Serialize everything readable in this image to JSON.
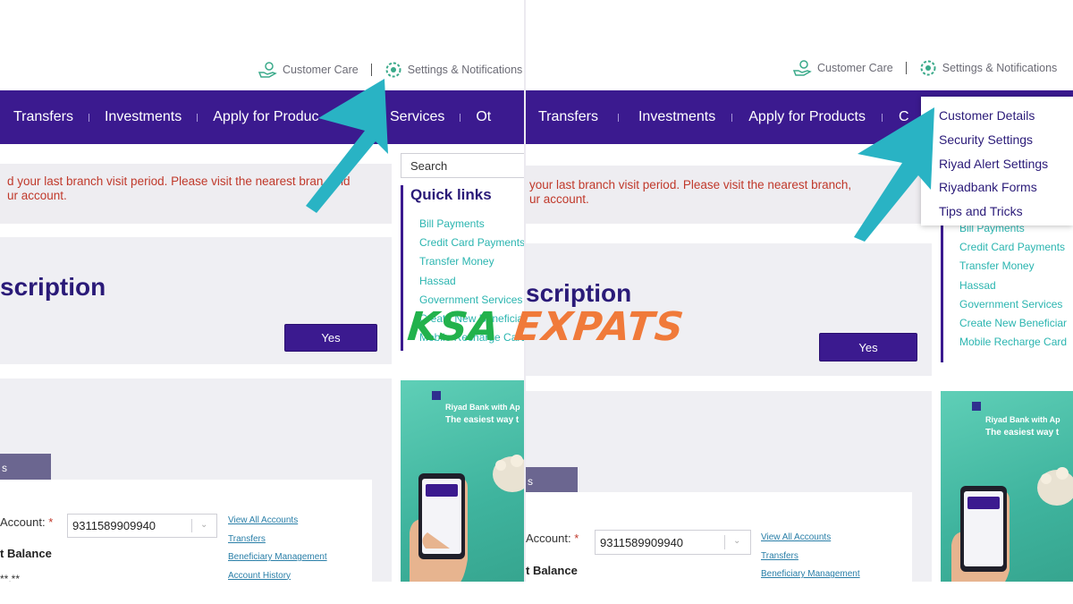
{
  "header": {
    "customer_care": "Customer Care",
    "settings_notifications": "Settings & Notifications"
  },
  "nav": {
    "left": [
      "Transfers",
      "Investments",
      "Apply for Produc",
      "Other Services",
      "Ot"
    ],
    "right": [
      "Transfers",
      "Investments",
      "Apply for Products",
      "C"
    ]
  },
  "alert": {
    "left_line1": "d your last branch visit period. Please visit the nearest bran",
    "left_line1_tail": ", and",
    "left_line2": "ur account.",
    "right_line1": "your last branch visit period. Please visit the nearest branch,",
    "right_line2": "ur account."
  },
  "subscription": {
    "title": "scription",
    "yes_label": "Yes"
  },
  "account": {
    "tab_label": "s",
    "account_label": "Account:",
    "required_mark": "*",
    "account_number": "9311589909940",
    "balance_label": "t Balance",
    "masked_balance": "**.**",
    "links": [
      "View All Accounts",
      "Transfers",
      "Beneficiary Management",
      "Account History"
    ]
  },
  "sidebar": {
    "search_placeholder": "Search",
    "quick_links_title": "Quick links",
    "quick_links_left": [
      "Bill Payments",
      "Credit Card Payments",
      "Transfer Money",
      "Hassad",
      "Government Services",
      "Create New Beneficiar",
      "Mobile Recharge Card"
    ],
    "quick_links_right": [
      "Bill Payments",
      "Credit Card Payments",
      "Transfer Money",
      "Hassad",
      "Government Services",
      "Create New Beneficiar",
      "Mobile Recharge Card"
    ]
  },
  "promo": {
    "line1": "Riyad Bank with Ap",
    "line2": "The easiest way t"
  },
  "settings_menu": {
    "items": [
      "Customer Details",
      "Security Settings",
      "Riyad Alert Settings",
      "Riyadbank Forms",
      "Tips and Tricks"
    ]
  },
  "watermark": {
    "part1": "KSA",
    "part2": "EXPATS"
  },
  "colors": {
    "nav_bg": "#3b1a8f",
    "brand_purple": "#2a1a78",
    "alert_red": "#c0392b",
    "link_teal": "#2bb5b0",
    "arrow_cyan": "#29b3c4",
    "watermark_green": "#22b24c",
    "watermark_orange": "#f07a3a"
  },
  "icons": [
    "customer-care-icon",
    "settings-gear-icon",
    "chevron-down-icon",
    "pointer-arrow-icon"
  ]
}
